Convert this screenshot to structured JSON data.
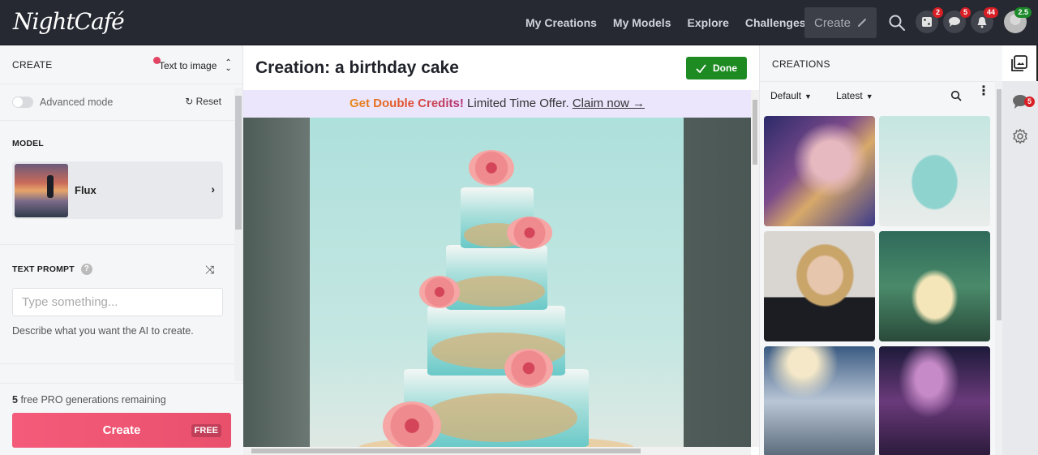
{
  "app": {
    "logo": "NightCafé"
  },
  "nav": {
    "links": [
      "My Creations",
      "My Models",
      "Explore",
      "Challenges"
    ],
    "create_label": "Create",
    "badges": {
      "dice": "2",
      "chat": "5",
      "notifications": "44",
      "credits": "2.5"
    }
  },
  "left": {
    "title": "CREATE",
    "mode": "Text to image",
    "advanced_mode_label": "Advanced mode",
    "advanced_mode_on": false,
    "reset_label": "Reset",
    "model_section": "MODEL",
    "model_name": "Flux",
    "prompt_section": "TEXT PROMPT",
    "prompt_placeholder": "Type something...",
    "prompt_value": "",
    "prompt_help": "Describe what you want the AI to create.",
    "remaining_count": "5",
    "remaining_text": "free PRO generations remaining",
    "create_button": "Create",
    "free_tag": "FREE"
  },
  "center": {
    "title": "Creation: a birthday cake",
    "done_label": "Done",
    "promo_highlight": "Get Double Credits!",
    "promo_text": " Limited Time Offer. ",
    "promo_link": "Claim now →",
    "image_alt": "A four-tier turquoise birthday cake decorated with pink roses and golden sprinkles"
  },
  "right": {
    "title": "CREATIONS",
    "sort_filter": "Default",
    "time_filter": "Latest",
    "thumbnails": [
      {
        "alt": "Glittery astronaut floating in space"
      },
      {
        "alt": "Four-tier turquoise birthday cake with pink roses"
      },
      {
        "alt": "Portrait of a blonde woman in a black blazer"
      },
      {
        "alt": "Woman in flowing dress in an enchanted forest"
      },
      {
        "alt": "Staircase into the clouds"
      },
      {
        "alt": "Staircase under a purple galaxy sky"
      }
    ]
  },
  "rail": {
    "chat_badge": "5"
  },
  "colors": {
    "topbar": "#262932",
    "create_accent": "#f45b7a",
    "done_green": "#1e8a22",
    "promo_bg": "#ebe6fc",
    "badge_red": "#d81f26",
    "badge_green": "#1c8a2a"
  }
}
